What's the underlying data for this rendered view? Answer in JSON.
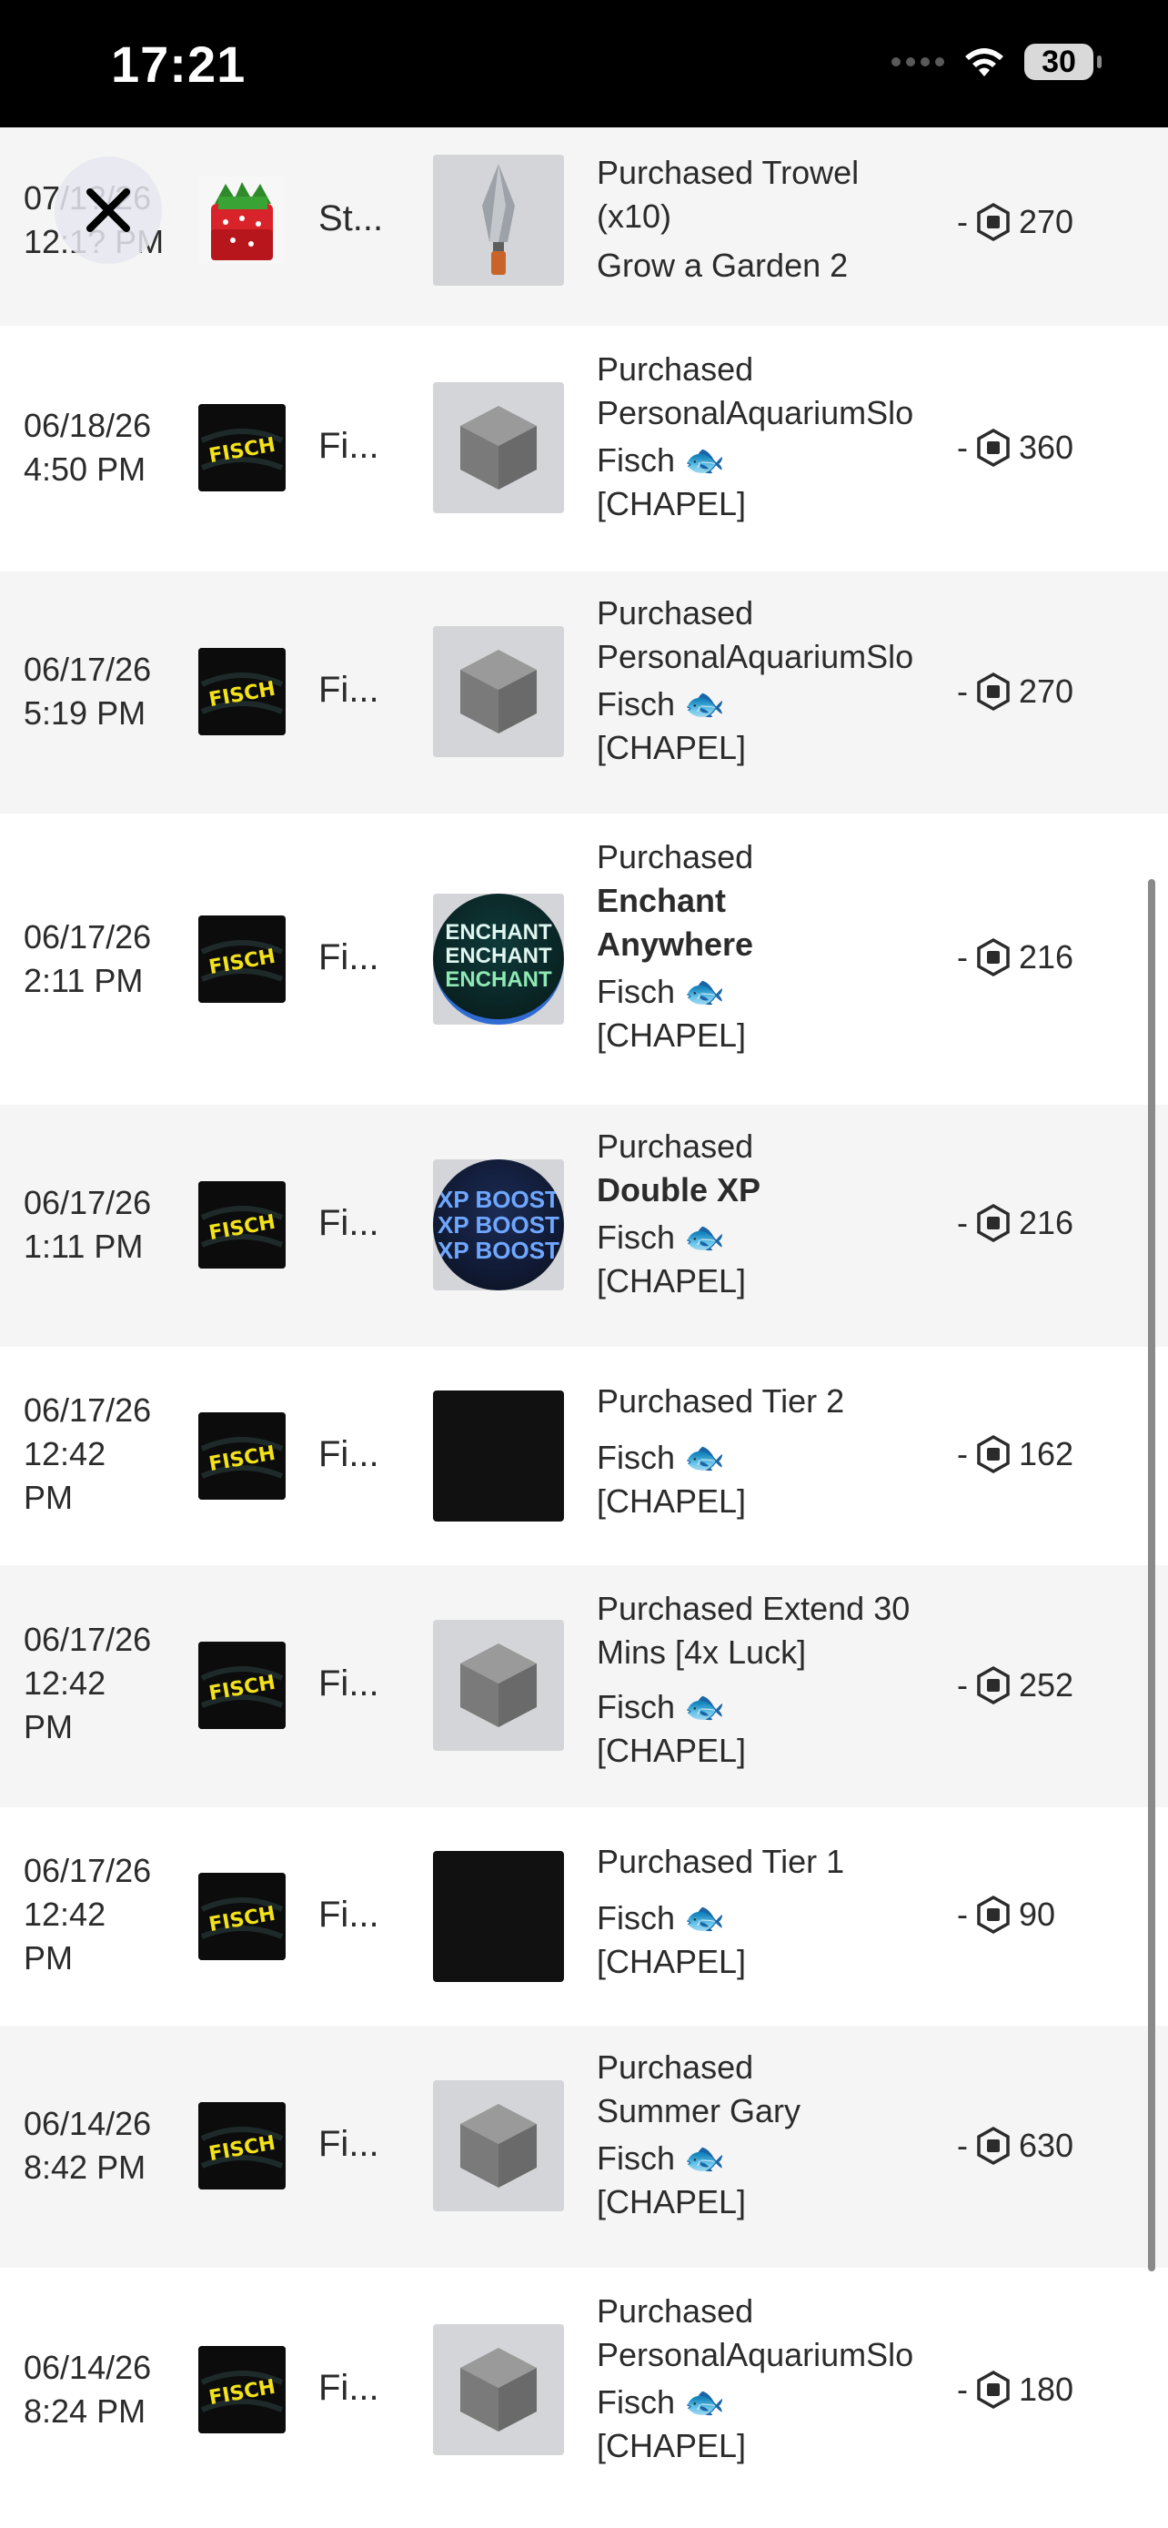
{
  "status": {
    "time": "17:21",
    "battery": "30"
  },
  "rows": [
    {
      "date": "07/1?/26",
      "time": "12:1? PM",
      "game": "St...",
      "title": "Purchased Trowel (x10)",
      "game_full": "Grow a Garden 2",
      "amount": "270",
      "sign": "-"
    },
    {
      "date": "06/18/26",
      "time": "4:50 PM",
      "game": "Fi...",
      "title": "Purchased PersonalAquariumSlo",
      "game_full_a": "Fisch 🐟",
      "game_full_b": "[CHAPEL]",
      "amount": "360",
      "sign": "-"
    },
    {
      "date": "06/17/26",
      "time": "5:19 PM",
      "game": "Fi...",
      "title": "Purchased PersonalAquariumSlo",
      "game_full_a": "Fisch 🐟",
      "game_full_b": "[CHAPEL]",
      "amount": "270",
      "sign": "-"
    },
    {
      "date": "06/17/26",
      "time": "2:11 PM",
      "game": "Fi...",
      "title_a": "Purchased",
      "title_b": "Enchant Anywhere",
      "game_full_a": "Fisch 🐟",
      "game_full_b": "[CHAPEL]",
      "amount": "216",
      "sign": "-",
      "thumb_text": "ENCHANT"
    },
    {
      "date": "06/17/26",
      "time": "1:11 PM",
      "game": "Fi...",
      "title_a": "Purchased",
      "title_b": "Double XP",
      "game_full_a": "Fisch 🐟",
      "game_full_b": "[CHAPEL]",
      "amount": "216",
      "sign": "-",
      "thumb_text": "XP BOOST"
    },
    {
      "date": "06/17/26",
      "time": "12:42",
      "time2": "PM",
      "game": "Fi...",
      "title": "Purchased Tier 2",
      "game_full_a": "Fisch 🐟",
      "game_full_b": "[CHAPEL]",
      "amount": "162",
      "sign": "-"
    },
    {
      "date": "06/17/26",
      "time": "12:42",
      "time2": "PM",
      "game": "Fi...",
      "title": "Purchased Extend 30 Mins [4x Luck]",
      "game_full_a": "Fisch 🐟",
      "game_full_b": "[CHAPEL]",
      "amount": "252",
      "sign": "-"
    },
    {
      "date": "06/17/26",
      "time": "12:42",
      "time2": "PM",
      "game": "Fi...",
      "title": "Purchased Tier 1",
      "game_full_a": "Fisch 🐟",
      "game_full_b": "[CHAPEL]",
      "amount": "90",
      "sign": "-"
    },
    {
      "date": "06/14/26",
      "time": "8:42 PM",
      "game": "Fi...",
      "title_a": "Purchased",
      "title_b": "Summer Gary",
      "game_full_a": "Fisch 🐟",
      "game_full_b": "[CHAPEL]",
      "amount": "630",
      "sign": "-"
    },
    {
      "date": "06/14/26",
      "time": "8:24 PM",
      "game": "Fi...",
      "title": "Purchased PersonalAquariumSlo",
      "game_full_a": "Fisch 🐟",
      "game_full_b": "[CHAPEL]",
      "amount": "180",
      "sign": "-"
    }
  ],
  "fisch_logo": "FISCH",
  "icons": {
    "close": "close-icon",
    "currency": "robux-icon"
  }
}
